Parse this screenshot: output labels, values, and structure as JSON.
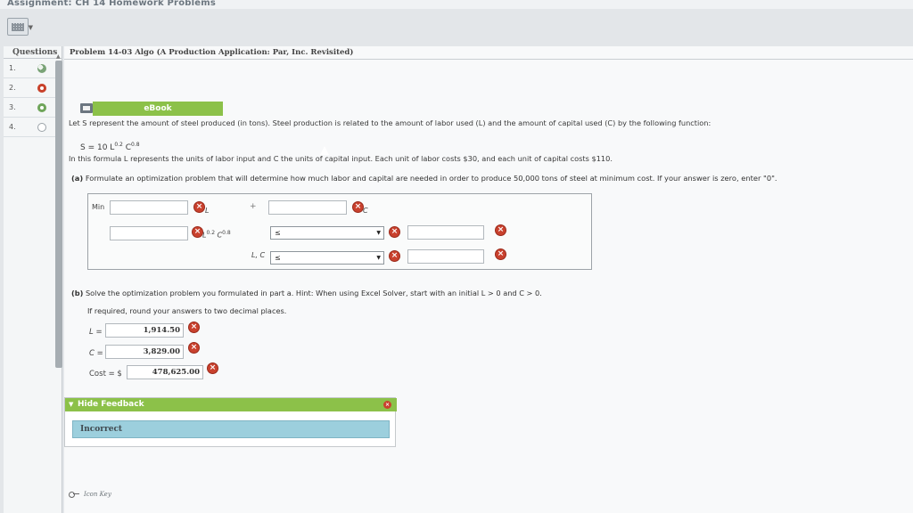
{
  "assignment": {
    "title": "Assignment: CH 14 Homework Problems"
  },
  "icons": {
    "calculator": "calculator-icon",
    "ebook": "ebook-icon",
    "wrong": "x-circle-icon",
    "key": "key-icon"
  },
  "colors": {
    "accent_green": "#8cc149",
    "error_red": "#c9412e",
    "incorrect_bg": "#9ccfdd"
  },
  "questions": {
    "header": "Questions",
    "items": [
      {
        "num": "1.",
        "status": "partial"
      },
      {
        "num": "2.",
        "status": "wrong"
      },
      {
        "num": "3.",
        "status": "correct"
      },
      {
        "num": "4.",
        "status": "empty"
      }
    ]
  },
  "problem": {
    "title": "Problem 14-03 Algo (A Production Application: Par, Inc. Revisited)",
    "ebook_label": "eBook",
    "intro": "Let S represent the amount of steel produced (in tons). Steel production is related to the amount of labor used (L) and the amount of capital used (C) by the following function:",
    "eq_prefix": "S = 10 L",
    "eq_exp1": "0.2",
    "eq_mid": " C",
    "eq_exp2": "0.8",
    "formula_text": "In this formula L represents the units of labor input and C the units of capital input. Each unit of labor costs $30, and each unit of capital costs $110.",
    "part_a_label": "(a)",
    "part_a_text": " Formulate an optimization problem that will determine how much labor and capital are needed in order to produce 50,000 tons of steel at minimum cost. If your answer is zero, enter \"0\".",
    "part_b_label": "(b)",
    "part_b_text": " Solve the optimization problem you formulated in part a. Hint: When using Excel Solver, start with an initial L > 0 and C > 0.",
    "round_text": "If required, round your answers to two decimal places."
  },
  "form_a": {
    "min_label": "Min",
    "var_L": "L",
    "plus": "+",
    "var_C": "C",
    "constraint_term": "L0.2 C0.8",
    "constraint_L": "L",
    "constraint_exp1": "0.2",
    "constraint_C": " C",
    "constraint_exp2": "0.8",
    "nonneg_label": "L, C",
    "select1": "≤",
    "select2": "≤"
  },
  "form_b": {
    "L_label": "L =",
    "L_value": "1,914.50",
    "C_label": "C =",
    "C_value": "3,829.00",
    "cost_label": "Cost = $",
    "cost_value": "478,625.00"
  },
  "feedback": {
    "bar_label": "Hide Feedback",
    "message": "Incorrect"
  },
  "footer": {
    "icon_key": "Icon Key"
  }
}
